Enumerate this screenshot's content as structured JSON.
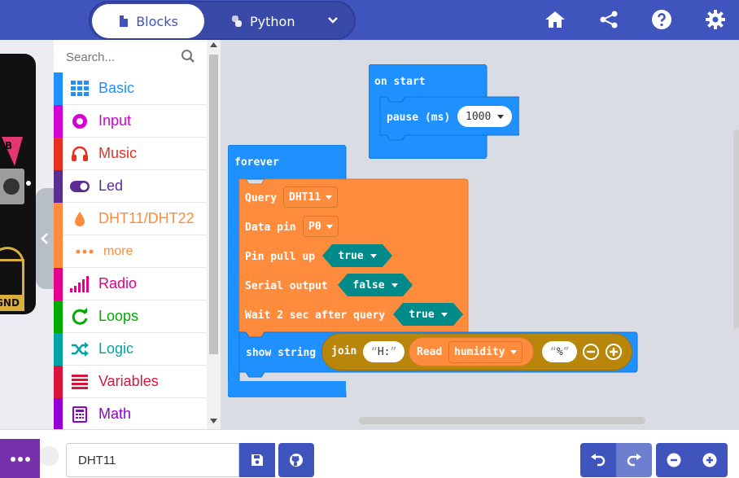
{
  "header": {
    "blocks_label": "Blocks",
    "python_label": "Python",
    "icons": [
      "home-icon",
      "share-icon",
      "help-icon",
      "settings-icon"
    ]
  },
  "simulator": {
    "pin_label": "GND",
    "button_label": "B"
  },
  "toolbox": {
    "search_placeholder": "Search...",
    "categories": [
      {
        "label": "Basic",
        "color": "#1e90ff",
        "icon": "grid-icon"
      },
      {
        "label": "Input",
        "color": "#d400d4",
        "icon": "target-icon"
      },
      {
        "label": "Music",
        "color": "#e63022",
        "icon": "headphones-icon"
      },
      {
        "label": "Led",
        "color": "#5c2d91",
        "icon": "toggle-icon"
      },
      {
        "label": "DHT11/DHT22",
        "color": "#ff8c3d",
        "icon": "drop-icon"
      },
      {
        "label": "more",
        "color": "#ff8c3d",
        "icon": "dots-icon"
      },
      {
        "label": "Radio",
        "color": "#e3008c",
        "icon": "signal-icon"
      },
      {
        "label": "Loops",
        "color": "#00aa00",
        "icon": "loop-icon"
      },
      {
        "label": "Logic",
        "color": "#00a4a6",
        "icon": "shuffle-icon"
      },
      {
        "label": "Variables",
        "color": "#dc143c",
        "icon": "lines-icon"
      },
      {
        "label": "Math",
        "color": "#9400d3",
        "icon": "calculator-icon"
      }
    ]
  },
  "workspace": {
    "on_start": {
      "label": "on start",
      "pause_label": "pause (ms)",
      "pause_value": "1000"
    },
    "forever": {
      "label": "forever",
      "query_label": "Query",
      "query_value": "DHT11",
      "data_pin_label": "Data pin",
      "data_pin_value": "P0",
      "pull_up_label": "Pin pull up",
      "pull_up_value": "true",
      "serial_label": "Serial output",
      "serial_value": "false",
      "wait_label": "Wait 2 sec after query",
      "wait_value": "true",
      "show_string_label": "show string",
      "join_label": "join",
      "join_first": "H:",
      "read_label": "Read",
      "read_value": "humidity",
      "join_last": "%"
    }
  },
  "bottombar": {
    "project_name": "DHT11"
  },
  "colors": {
    "header": "#4054bd",
    "loops": "#1e90ff",
    "dht": "#ff8c3d",
    "logic": "#008a8a",
    "text": "#b8860b"
  }
}
